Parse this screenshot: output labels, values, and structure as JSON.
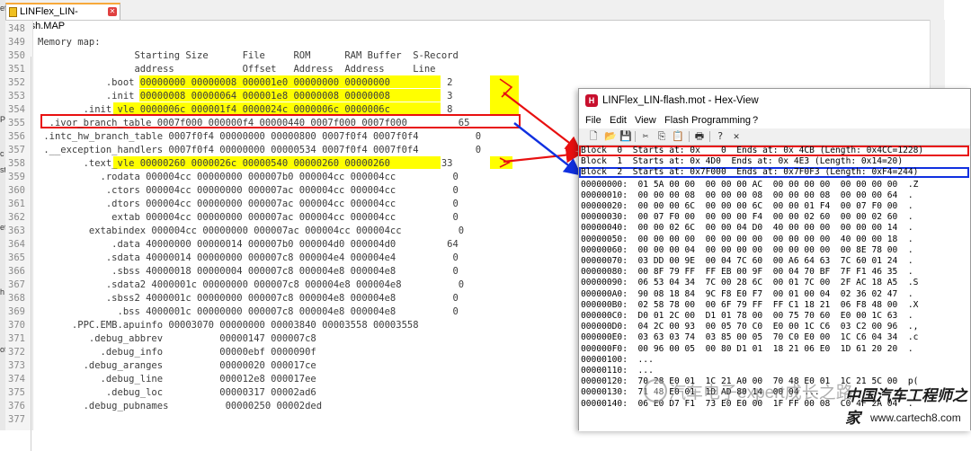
{
  "left_strip": [
    "ef",
    "P",
    "c",
    "st",
    "ef",
    "h",
    "of"
  ],
  "editor": {
    "tab_label": "LINFlex_LIN-flash.MAP",
    "line_numbers": [
      "348",
      "349",
      "350",
      "351",
      "352",
      "353",
      "354",
      "355",
      "356",
      "357",
      "358",
      "359",
      "360",
      "361",
      "362",
      "363",
      "364",
      "365",
      "366",
      "367",
      "368",
      "369",
      "370",
      "371",
      "372",
      "373",
      "374",
      "375",
      "376",
      "377"
    ],
    "lines": [
      "",
      "Memory map:",
      "                 Starting Size      File     ROM      RAM Buffer  S-Record",
      "                 address            Offset   Address  Address     Line",
      "            .boot 00000000 00000008 000001e0 00000000 00000000          2",
      "            .init 00000008 00000064 000001e8 00000008 00000008          3",
      "        .init_vle 0000006c 000001f4 0000024c 0000006c 0000006c          8",
      "  .ivor_branch_table 0007f000 000000f4 00000440 0007f000 0007f000         65",
      " .intc_hw_branch_table 0007f0f4 00000000 00000800 0007f0f4 0007f0f4          0",
      " .__exception_handlers 0007f0f4 00000000 00000534 0007f0f4 0007f0f4          0",
      "        .text_vle 00000260 0000026c 00000540 00000260 00000260         33",
      "           .rodata 000004cc 00000000 000007b0 000004cc 000004cc          0",
      "            .ctors 000004cc 00000000 000007ac 000004cc 000004cc          0",
      "            .dtors 000004cc 00000000 000007ac 000004cc 000004cc          0",
      "             extab 000004cc 00000000 000007ac 000004cc 000004cc          0",
      "         extabindex 000004cc 00000000 000007ac 000004cc 000004cc          0",
      "             .data 40000000 00000014 000007b0 000004d0 000004d0         64",
      "            .sdata 40000014 00000000 000007c8 000004e4 000004e4          0",
      "             .sbss 40000018 00000004 000007c8 000004e8 000004e8          0",
      "            .sdata2 4000001c 00000000 000007c8 000004e8 000004e8          0",
      "            .sbss2 4000001c 00000000 000007c8 000004e8 000004e8          0",
      "              .bss 4000001c 00000000 000007c8 000004e8 000004e8          0",
      "      .PPC.EMB.apuinfo 00003070 00000000 00003840 00003558 00003558",
      "         .debug_abbrev          00000147 000007c8",
      "           .debug_info          00000ebf 0000090f",
      "        .debug_aranges          00000020 000017ce",
      "           .debug_line          000012e8 000017ee",
      "            .debug_loc          00000317 00002ad6",
      "        .debug_pubnames          00000250 00002ded",
      ""
    ]
  },
  "hexview": {
    "title_file": "LINFlex_LIN-flash.mot",
    "title_sep": " - ",
    "title_app": "Hex-View",
    "app_icon": "H",
    "menus": [
      "File",
      "Edit",
      "View",
      "Flash Programming",
      "?"
    ],
    "toolbar_icons": [
      "new-file-icon",
      "open-folder-icon",
      "save-icon",
      "cut-icon",
      "copy-icon",
      "paste-icon",
      "print-icon",
      "help-icon",
      "close-icon"
    ],
    "blocks": [
      "Block  0  Starts at: 0x    0  Ends at: 0x 4CB (Length: 0x4CC=1228)",
      "Block  1  Starts at: 0x 4D0  Ends at: 0x 4E3 (Length: 0x14=20)",
      "Block  2  Starts at: 0x7F000  Ends at: 0x7F0F3 (Length: 0xF4=244)"
    ],
    "rows": [
      "00000000:  01 5A 00 00  00 00 00 AC  00 00 00 00  00 00 00 00  .Z",
      "00000010:  00 00 00 08  00 00 00 08  00 00 00 08  00 00 00 64  .",
      "00000020:  00 00 00 6C  00 00 00 6C  00 00 01 F4  00 07 F0 00  .",
      "00000030:  00 07 F0 00  00 00 00 F4  00 00 02 60  00 00 02 60  .",
      "00000040:  00 00 02 6C  00 00 04 D0  40 00 00 00  00 00 00 14  .",
      "00000050:  00 00 00 00  00 00 00 00  00 00 00 00  40 00 00 18  .",
      "00000060:  00 00 00 04  00 00 00 00  00 00 00 00  00 8E 78 00  .",
      "00000070:  03 DD 00 9E  00 04 7C 60  00 A6 64 63  7C 60 01 24  .",
      "00000080:  00 8F 79 FF  FF EB 00 9F  00 04 70 BF  7F F1 46 35  .",
      "00000090:  06 53 04 34  7C 00 28 6C  00 01 7C 00  2F AC 18 A5  .S",
      "000000A0:  90 08 18 84  9C F8 E0 F7  00 01 00 04  02 36 02 47  .",
      "000000B0:  02 58 78 00  00 6F 79 FF  FF C1 18 21  06 F8 48 00  .X",
      "000000C0:  D0 01 2C 00  D1 01 78 00  00 75 70 60  E0 00 1C 63  .",
      "000000D0:  04 2C 00 93  00 05 70 C0  E0 00 1C C6  03 C2 00 96  .,",
      "000000E0:  03 63 03 74  03 85 00 05  70 C0 E0 00  1C C6 04 34  .c",
      "000000F0:  00 96 00 05  00 80 D1 01  18 21 06 E0  1D 61 20 20  .",
      "00000100:  ...",
      "00000110:  ...",
      "00000120:  70 28 E0 01  1C 21 A0 00  70 48 E0 01  1C 21 5C 00  p(",
      "00000130:  71 48 E0 01  1D AD 80 14  00 04 ...",
      "00000140:  06 E0 D7 F1  73 E0 E0 00  1F FF 00 08  C0 4F 2A 04  ."
    ]
  },
  "colors": {
    "highlight": "#ffff00",
    "red": "#e81010",
    "blue": "#1030e0",
    "app_icon": "#c8102e",
    "tab_accent": "#f7a93b"
  },
  "watermark": {
    "text1": "汽车电子expert成长之路",
    "text2": "中国汽车工程师之家",
    "text3": "www.cartech8.com"
  }
}
